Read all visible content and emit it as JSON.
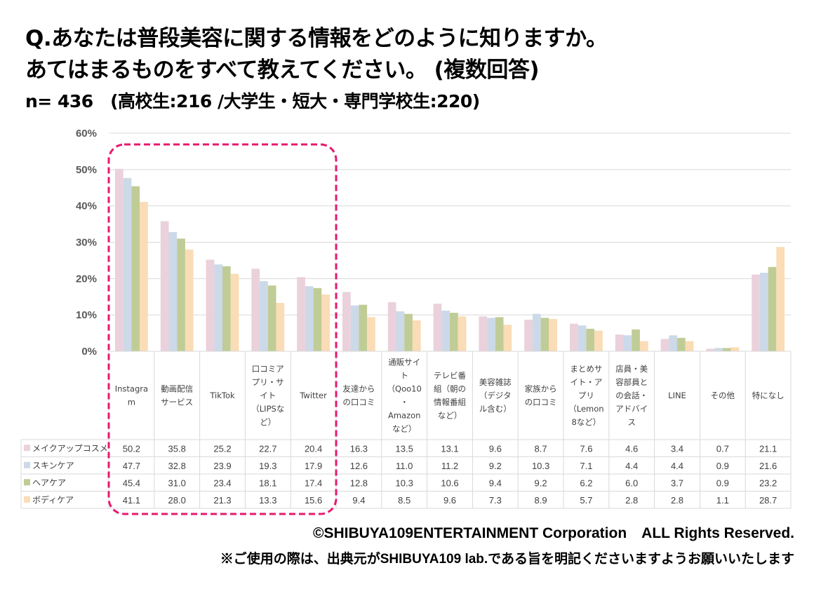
{
  "title": {
    "line1": "Q.あなたは普段美容に関する情報をどのように知りますか。",
    "line2": "あてはまるものをすべて教えてください。 (複数回答)",
    "sample": "n= 436　(高校生:216 /大学生・短大・専門学校生:220)"
  },
  "footer": {
    "copyright": "©SHIBUYA109ENTERTAINMENT Corporation　ALL Rights Reserved.",
    "note": "※ご使用の際は、出典元がSHIBUYA109 lab.である旨を明記くださいますようお願いいたします"
  },
  "highlight": {
    "color": "#e6186e",
    "from_category": 0,
    "to_category": 4
  },
  "chart_data": {
    "type": "bar",
    "title": "",
    "xlabel": "",
    "ylabel": "",
    "ylim": [
      0,
      60
    ],
    "yticks": [
      0,
      10,
      20,
      30,
      40,
      50,
      60
    ],
    "ytick_labels": [
      "0%",
      "10%",
      "20%",
      "30%",
      "40%",
      "50%",
      "60%"
    ],
    "grid": true,
    "legend_position": "data-table-left",
    "categories": [
      "Instagram",
      "動画配信サービス",
      "TikTok",
      "口コミアプリ・サイト（LIPSなど）",
      "Twitter",
      "友達からの口コミ",
      "通販サイト（Qoo10・Amazonなど）",
      "テレビ番組（朝の情報番組など）",
      "美容雑誌（デジタル含む）",
      "家族からの口コミ",
      "まとめサイト・アプリ（Lemon8など）",
      "店員・美容部員との会話・アドバイス",
      "LINE",
      "その他",
      "特になし"
    ],
    "category_lines": [
      [
        "Instagra",
        "m"
      ],
      [
        "動画配信",
        "サービス"
      ],
      [
        "TikTok"
      ],
      [
        "口コミア",
        "プリ・サ",
        "イト",
        "（LIPSな",
        "ど）"
      ],
      [
        "Twitter"
      ],
      [
        "友達から",
        "の口コミ"
      ],
      [
        "通販サイ",
        "ト",
        "（Qoo10",
        "・",
        "Amazon",
        "など）"
      ],
      [
        "テレビ番",
        "組（朝の",
        "情報番組",
        "など）"
      ],
      [
        "美容雑誌",
        "（デジタ",
        "ル含む）"
      ],
      [
        "家族から",
        "の口コミ"
      ],
      [
        "まとめサ",
        "イト・ア",
        "プリ",
        "（Lemon",
        "8など）"
      ],
      [
        "店員・美",
        "容部員と",
        "の会話・",
        "アドバイ",
        "ス"
      ],
      [
        "LINE"
      ],
      [
        "その他"
      ],
      [
        "特になし"
      ]
    ],
    "series": [
      {
        "name": "メイクアップコスメ",
        "color": "#ead1dc",
        "values": [
          50.2,
          35.8,
          25.2,
          22.7,
          20.4,
          16.3,
          13.5,
          13.1,
          9.6,
          8.7,
          7.6,
          4.6,
          3.4,
          0.7,
          21.1
        ]
      },
      {
        "name": "スキンケア",
        "color": "#ccd9e8",
        "values": [
          47.7,
          32.8,
          23.9,
          19.3,
          17.9,
          12.6,
          11.0,
          11.2,
          9.2,
          10.3,
          7.1,
          4.4,
          4.4,
          0.9,
          21.6
        ]
      },
      {
        "name": "ヘアケア",
        "color": "#c0cc96",
        "values": [
          45.4,
          31.0,
          23.4,
          18.1,
          17.4,
          12.8,
          10.3,
          10.6,
          9.4,
          9.2,
          6.2,
          6.0,
          3.7,
          0.9,
          23.2
        ]
      },
      {
        "name": "ボディケア",
        "color": "#fadcb6",
        "values": [
          41.1,
          28.0,
          21.3,
          13.3,
          15.6,
          9.4,
          8.5,
          9.6,
          7.3,
          8.9,
          5.7,
          2.8,
          2.8,
          1.1,
          28.7
        ]
      }
    ]
  }
}
